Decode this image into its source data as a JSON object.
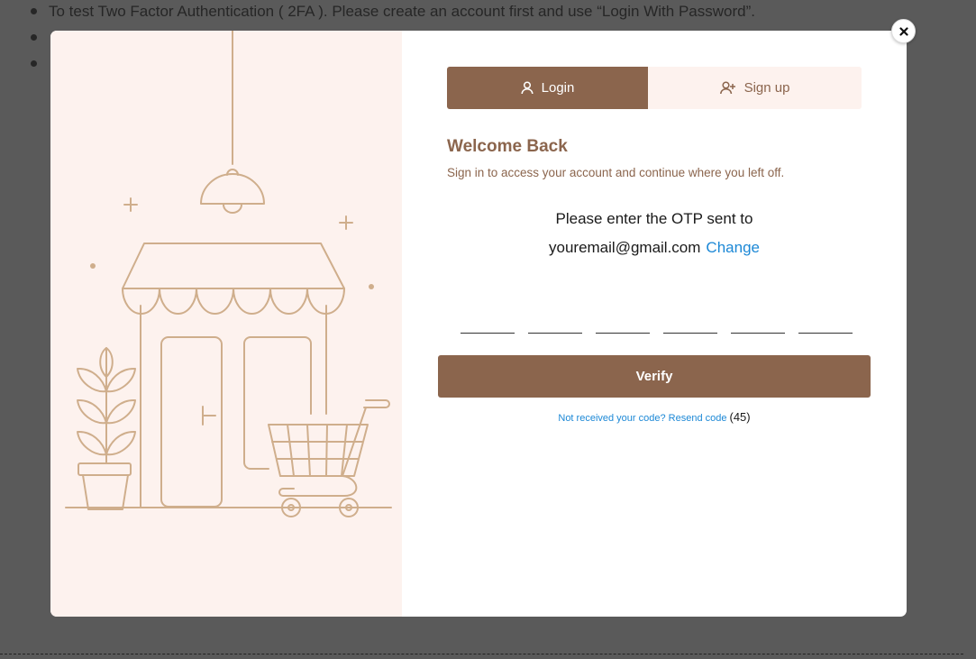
{
  "background": {
    "bullets": [
      "To test Two Factor Authentication ( 2FA ). Please create an account first and use “Login With Password”.",
      "",
      ""
    ]
  },
  "modal": {
    "close_icon": "close-icon",
    "tabs": [
      {
        "label": "Login",
        "icon": "user-icon",
        "active": true
      },
      {
        "label": "Sign up",
        "icon": "user-plus-icon",
        "active": false
      }
    ],
    "welcome_title": "Welcome Back",
    "welcome_subtitle": "Sign in to access your account and continue where you left off.",
    "otp_prompt": "Please enter the OTP sent to",
    "otp_email": "youremail@gmail.com",
    "otp_change_label": "Change",
    "otp_digits": [
      "",
      "",
      "",
      "",
      "",
      ""
    ],
    "verify_label": "Verify",
    "resend_text": "Not received your code? Resend code",
    "resend_countdown": "(45)"
  },
  "colors": {
    "brand": "#8b654d",
    "illustration_bg": "#fdf2ee",
    "illustration_line": "#cfae8c",
    "link": "#1c88d6",
    "overlay": "#5a5a5a"
  }
}
